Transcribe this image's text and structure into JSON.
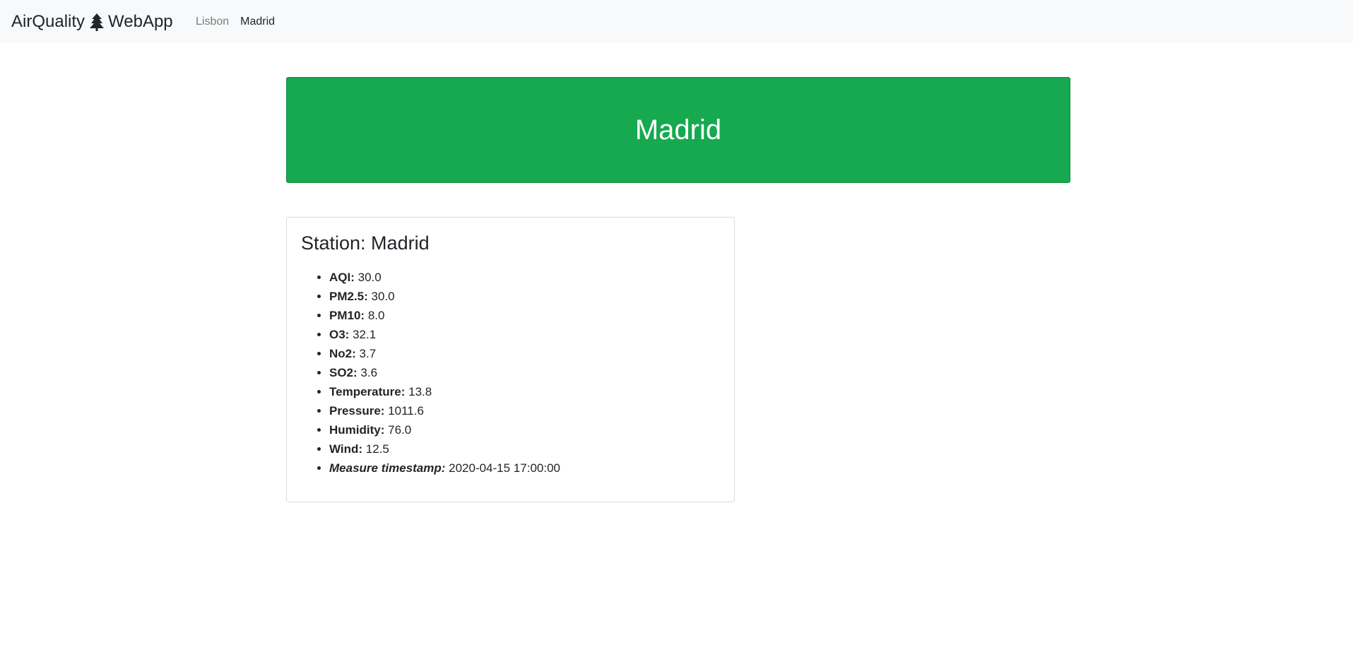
{
  "navbar": {
    "brand_left": "AirQuality",
    "brand_right": "WebApp",
    "brand_icon": "tree-icon",
    "links": [
      {
        "label": "Lisbon",
        "active": false
      },
      {
        "label": "Madrid",
        "active": true
      }
    ]
  },
  "hero": {
    "title": "Madrid",
    "color": "#16a950"
  },
  "station": {
    "title": "Station: Madrid",
    "items": [
      {
        "label": "AQI:",
        "value": "30.0"
      },
      {
        "label": "PM2.5:",
        "value": "30.0"
      },
      {
        "label": "PM10:",
        "value": "8.0"
      },
      {
        "label": "O3:",
        "value": "32.1"
      },
      {
        "label": "No2:",
        "value": "3.7"
      },
      {
        "label": "SO2:",
        "value": "3.6"
      },
      {
        "label": "Temperature:",
        "value": "13.8"
      },
      {
        "label": "Pressure:",
        "value": "1011.6"
      },
      {
        "label": "Humidity:",
        "value": "76.0"
      },
      {
        "label": "Wind:",
        "value": "12.5"
      },
      {
        "label": "Measure timestamp:",
        "value": "2020-04-15 17:00:00"
      }
    ]
  }
}
